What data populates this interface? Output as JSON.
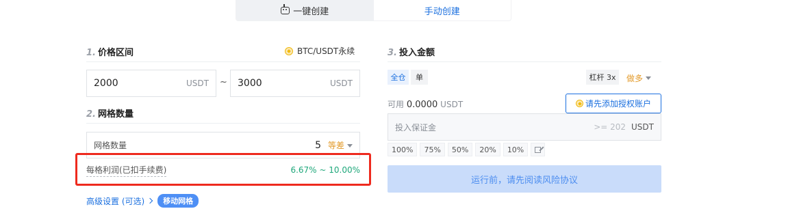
{
  "tabs": {
    "auto_label": "一键创建",
    "manual_label": "手动创建"
  },
  "price_range": {
    "num": "1.",
    "title": "价格区间",
    "pair": "BTC/USDT永续",
    "low": "2000",
    "high": "3000",
    "unit": "USDT",
    "separator": "~"
  },
  "grid_count": {
    "num": "2.",
    "title": "网格数量",
    "label": "网格数量",
    "value": "5",
    "mode": "等差"
  },
  "profit": {
    "label": "每格利润(已扣手续费)",
    "value": "6.67% ~ 10.00%"
  },
  "advanced": {
    "label": "高级设置 (可选)",
    "badge": "移动网格"
  },
  "invest": {
    "num": "3.",
    "title": "投入金额",
    "cross_label": "全仓",
    "isolated_label": "单",
    "leverage_label": "杠杆 3x",
    "direction_label": "做多",
    "available_label": "可用",
    "available_amount": "0.0000",
    "available_unit": "USDT",
    "auth_button": "请先添加授权账户",
    "input_placeholder": "投入保证金",
    "min_hint": ">= 202",
    "unit": "USDT",
    "percents": [
      "100%",
      "75%",
      "50%",
      "20%",
      "10%"
    ],
    "run_button": "运行前，请先阅读风险协议"
  },
  "colors": {
    "accent": "#1a6fdf",
    "highlight": "#ee2a1e",
    "profit": "#1ea77a",
    "mode": "#e39b2b"
  },
  "icons": [
    "robot-icon",
    "coin-icon",
    "chevron-down-icon",
    "chevron-right-icon",
    "edit-icon"
  ]
}
